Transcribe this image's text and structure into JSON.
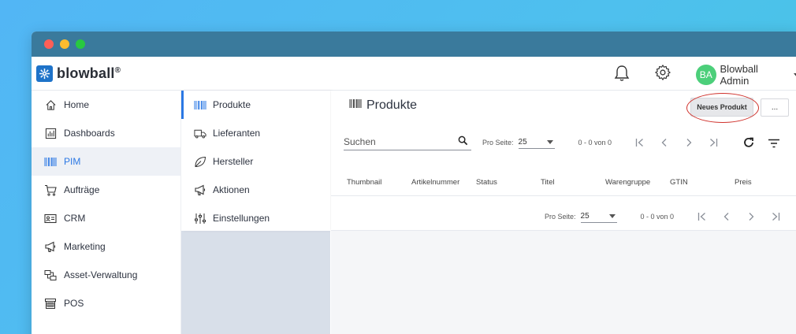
{
  "app": {
    "brand": "blowball",
    "brand_mark": "®",
    "user_initials": "BA",
    "user_name": "Blowball Admin",
    "colors": {
      "accent": "#2b78e4",
      "avatar": "#4ccf7a",
      "highlight": "#d0322c",
      "logo": "#1e73c9"
    }
  },
  "sidebar": {
    "items": [
      {
        "label": "Home",
        "icon": "home-icon"
      },
      {
        "label": "Dashboards",
        "icon": "dashboard-icon"
      },
      {
        "label": "PIM",
        "icon": "barcode-icon",
        "active": true
      },
      {
        "label": "Aufträge",
        "icon": "cart-icon"
      },
      {
        "label": "CRM",
        "icon": "contact-card-icon"
      },
      {
        "label": "Marketing",
        "icon": "megaphone-icon"
      },
      {
        "label": "Asset-Verwaltung",
        "icon": "assets-icon"
      },
      {
        "label": "POS",
        "icon": "store-icon"
      }
    ]
  },
  "subnav": {
    "items": [
      {
        "label": "Produkte",
        "icon": "barcode-icon",
        "active": true
      },
      {
        "label": "Lieferanten",
        "icon": "truck-icon"
      },
      {
        "label": "Hersteller",
        "icon": "leaf-icon"
      },
      {
        "label": "Aktionen",
        "icon": "megaphone-icon"
      },
      {
        "label": "Einstellungen",
        "icon": "sliders-icon"
      }
    ]
  },
  "main": {
    "title": "Produkte",
    "new_button": "Neues Produkt",
    "more_button": "...",
    "search_placeholder": "Suchen",
    "pager_top": {
      "label": "Pro Seite:",
      "per_page": "25",
      "range": "0 - 0 von 0"
    },
    "pager_bottom": {
      "label": "Pro Seite:",
      "per_page": "25",
      "range": "0 - 0 von 0"
    },
    "columns": [
      "Thumbnail",
      "Artikelnummer",
      "Status",
      "Titel",
      "Warengruppe",
      "GTIN",
      "Preis"
    ]
  }
}
